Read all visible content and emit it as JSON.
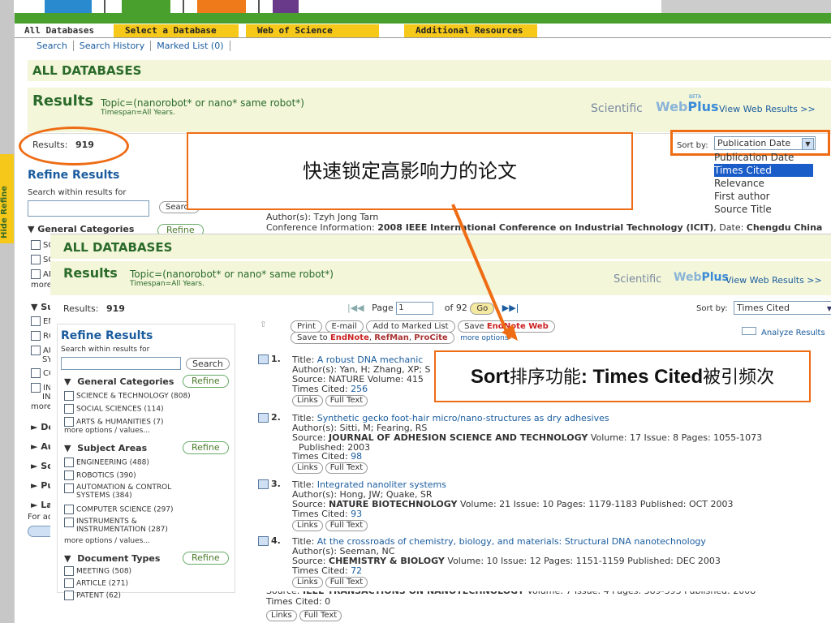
{
  "tabs": {
    "all_databases": "All Databases",
    "select_database": "Select a Database",
    "web_of_science": "Web of Science",
    "additional_resources": "Additional Resources"
  },
  "subnav": {
    "search": "Search",
    "search_history": "Search History",
    "marked_list": "Marked List (0)"
  },
  "page_title": "ALL DATABASES",
  "results_title": "Results",
  "query": "Topic=(nanorobot* or nano* same robot*)",
  "timespan": "Timespan=All Years.",
  "scientific": "Scientific",
  "webplus_web": "Web",
  "webplus_plus": "Plus",
  "webplus_beta": "BETA",
  "view_web_results": "View Web Results >>",
  "results_label": "Results:",
  "results_count": "919",
  "sort_by_label": "Sort by:",
  "sort_selected": "Publication Date",
  "sort_options": [
    "Publication Date",
    "Times Cited",
    "Relevance",
    "First author",
    "Source Title"
  ],
  "callout1": "快速锁定高影响力的论文",
  "callout2_a": "Sort",
  "callout2_b": "排序功能",
  "callout2_c": ": Times Cited",
  "callout2_d": "被引频次",
  "hide_refine": "Hide Refine",
  "back": {
    "refine_results": "Refine Results",
    "search_within": "Search within results for",
    "search_btn": "Search",
    "general_categories": "General Categories",
    "refine_btn": "Refine",
    "author_line": "Author(s): Tzyh Jong Tarn",
    "conf_label": "Conference Information:",
    "conf_value": "2008 IEEE International Conference on Industrial Technology (ICIT)",
    "date_label": ", Date:",
    "date_value": "Chengdu China",
    "cat_sc1": "SC",
    "cat_sc2": "SC",
    "cat_ar": "AR",
    "more": "more",
    "sec_su": "Su",
    "en": "EN",
    "ro": "RO",
    "au": "AU",
    "sy": "SY",
    "co": "CO",
    "ins1": "INS",
    "ins2": "INS",
    "more2": "more",
    "do": "Do",
    "au2": "Au",
    "so": "So",
    "pu": "Pu",
    "la": "La",
    "for_adv": "For adv",
    "source_label": "Source:",
    "source_tail": "IEEE TRANSACTIONS ON NANOTECHNOLOGY",
    "source_tail_vol": "Volume: 7  Issue: 4  Pages: 389-393  Published: 2008",
    "times_cited_tail": "Times Cited: 0",
    "links": "Links",
    "full_text": "Full Text"
  },
  "front": {
    "title": "ALL DATABASES",
    "results": "Results",
    "query": "Topic=(nanorobot* or nano* same robot*)",
    "timespan": "Timespan=All Years.",
    "results_label": "Results:",
    "results_count": "919",
    "page_label": "Page",
    "page_value": "1",
    "of_pages": "of 92",
    "go": "Go",
    "sort_by": "Sort by:",
    "sort_value": "Times Cited",
    "print": "Print",
    "email": "E-mail",
    "add_marked": "Add to Marked List",
    "save": "Save",
    "endnote_web": "EndNote Web",
    "save_to": "Save to",
    "endnote": "EndNote",
    "refman": "RefMan",
    "procite": "ProCite",
    "more_options": "more options",
    "analyze": "Analyze Results",
    "refine_results": "Refine Results",
    "search_within": "Search within results for",
    "search_btn": "Search",
    "general_categories": "General Categories",
    "refine": "Refine",
    "gen_items": [
      "SCIENCE & TECHNOLOGY (808)",
      "SOCIAL SCIENCES (114)",
      "ARTS & HUMANITIES (7)"
    ],
    "more_values": "more options / values...",
    "subject_areas": "Subject Areas",
    "subj_items": [
      "ENGINEERING (488)",
      "ROBOTICS (390)",
      "AUTOMATION & CONTROL SYSTEMS (384)",
      "COMPUTER SCIENCE (297)",
      "INSTRUMENTS & INSTRUMENTATION (287)"
    ],
    "document_types": "Document Types",
    "doc_items": [
      "MEETING (508)",
      "ARTICLE (271)",
      "PATENT (62)"
    ],
    "records": [
      {
        "num": "1.",
        "title_label": "Title:",
        "title": "A robust DNA mechanic",
        "authors": "Author(s): Yan, H; Zhang, XP; S",
        "source": "Source: NATURE  Volume: 415",
        "cited_label": "Times Cited:",
        "cited": "256"
      },
      {
        "num": "2.",
        "title_label": "Title:",
        "title": "Synthetic gecko foot-hair micro/nano-structures as dry adhesives",
        "authors": "Author(s): Sitti, M; Fearing, RS",
        "source_pre": "Source:",
        "source_name": "JOURNAL OF ADHESION SCIENCE AND TECHNOLOGY",
        "source_vol": "Volume: 17  Issue: 8  Pages: 1055-1073",
        "published": "Published: 2003",
        "cited_label": "Times Cited:",
        "cited": "98"
      },
      {
        "num": "3.",
        "title_label": "Title:",
        "title": "Integrated nanoliter systems",
        "authors": "Author(s): Hong, JW; Quake, SR",
        "source_pre": "Source:",
        "source_name": "NATURE BIOTECHNOLOGY",
        "source_vol": "Volume: 21  Issue: 10  Pages: 1179-1183  Published: OCT 2003",
        "cited_label": "Times Cited:",
        "cited": "93"
      },
      {
        "num": "4.",
        "title_label": "Title:",
        "title": "At the crossroads of chemistry, biology, and materials: Structural DNA nanotechnology",
        "authors": "Author(s): Seeman, NC",
        "source_pre": "Source:",
        "source_name": "CHEMISTRY & BIOLOGY",
        "source_vol": "Volume: 10  Issue: 12  Pages: 1151-1159  Published: DEC 2003",
        "cited_label": "Times Cited:",
        "cited": "72"
      }
    ]
  },
  "colors": {
    "green": "#4aa02c",
    "orange": "#ee6c14",
    "tab_yellow": "#f7d21c",
    "purple": "#6a3a8a",
    "teal": "#1aa0a0"
  }
}
